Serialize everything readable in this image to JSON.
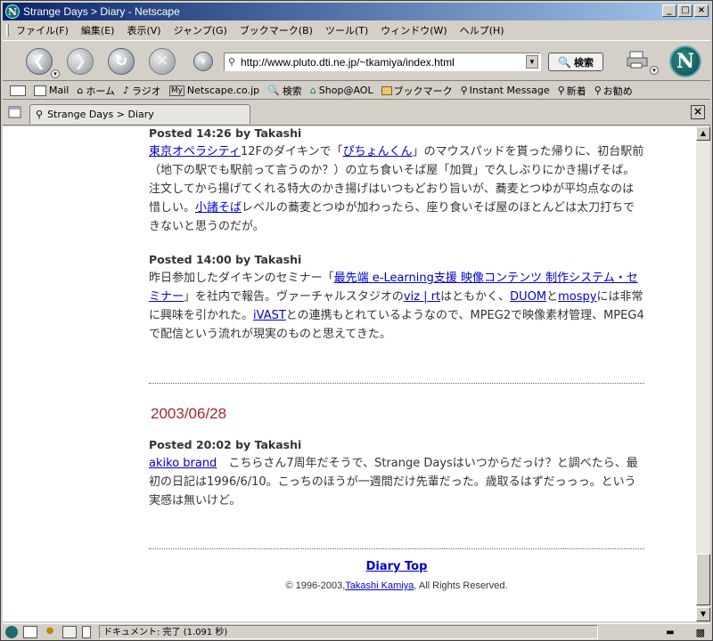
{
  "window": {
    "title": "Strange Days > Diary - Netscape",
    "min_symbol": "_",
    "max_symbol": "□",
    "close_symbol": "×"
  },
  "menu": {
    "items": [
      "ファイル(F)",
      "編集(E)",
      "表示(V)",
      "ジャンプ(G)",
      "ブックマーク(B)",
      "ツール(T)",
      "ウィンドウ(W)",
      "ヘルプ(H)"
    ]
  },
  "navbar": {
    "url": "http://www.pluto.dti.ne.jp/~tkamiya/index.html",
    "search_label": "検索",
    "logo_letter": "N"
  },
  "personal": {
    "items": [
      "Mail",
      "ホーム",
      "ラジオ",
      "Netscape.co.jp",
      "検索",
      "Shop@AOL",
      "ブックマーク",
      "Instant Message",
      "新着",
      "お勧め"
    ]
  },
  "tab": {
    "title": "Strange Days > Diary"
  },
  "entries": [
    {
      "posted": "Posted 14:26 by Takashi",
      "segments": [
        {
          "t": "東京オペラシティ",
          "link": true
        },
        {
          "t": "12Fのダイキンで「",
          "link": false
        },
        {
          "t": "ぴちょんくん",
          "link": true
        },
        {
          "t": "」のマウスパッドを貰った帰りに、初台駅前（地下の駅でも駅前って言うのか？）の立ち食いそば屋「加賀」で久しぶりにかき揚げそば。注文してから揚げてくれる特大のかき揚げはいつもどおり旨いが、蕎麦とつゆが平均点なのは惜しい。",
          "link": false
        },
        {
          "t": "小諸そば",
          "link": true
        },
        {
          "t": "レベルの蕎麦とつゆが加わったら、座り食いそば屋のほとんどは太刀打ちできないと思うのだが。",
          "link": false
        }
      ]
    },
    {
      "posted": "Posted 14:00 by Takashi",
      "segments": [
        {
          "t": "昨日参加したダイキンのセミナー「",
          "link": false
        },
        {
          "t": "最先端 e-Learning支援 映像コンテンツ 制作システム・セミナー",
          "link": true
        },
        {
          "t": "」を社内で報告。ヴァーチャルスタジオの",
          "link": false
        },
        {
          "t": "viz | rt",
          "link": true
        },
        {
          "t": "はともかく、",
          "link": false
        },
        {
          "t": "DUOM",
          "link": true
        },
        {
          "t": "と",
          "link": false
        },
        {
          "t": "mospy",
          "link": true
        },
        {
          "t": "には非常に興味を引かれた。",
          "link": false
        },
        {
          "t": "iVAST",
          "link": true
        },
        {
          "t": "との連携もとれているようなので、MPEG2で映像素材管理、MPEG4で配信という流れが現実のものと思えてきた。",
          "link": false
        }
      ]
    }
  ],
  "date_heading": "2003/06/28",
  "entry3": {
    "posted": "Posted 20:02 by Takashi",
    "segments": [
      {
        "t": "akiko brand",
        "link": true
      },
      {
        "t": "　こちらさん7周年だそうで、Strange Daysはいつからだっけ？と調べたら、最初の日記は1996/6/10。こっちのほうが一週間だけ先輩だった。歳取るはずだっっっ。という実感は無いけど。",
        "link": false
      }
    ]
  },
  "footer": {
    "diary_top": "Diary Top",
    "copyright_prefix": "© 1996-2003,",
    "author": "Takashi Kamiya",
    "copyright_suffix": ", All Rights Reserved."
  },
  "status": {
    "text": "ドキュメント: 完了 (1.091 秒)"
  }
}
